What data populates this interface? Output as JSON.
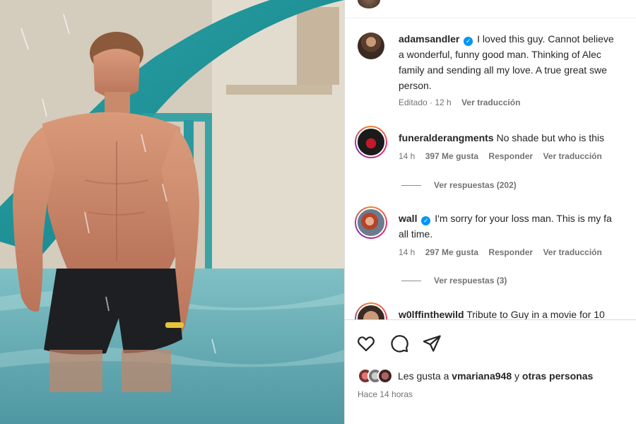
{
  "post": {
    "caption": {
      "username": "adamsandler",
      "lines": [
        "I loved this guy. Cannot believe",
        "a wonderful, funny good man. Thinking of Alec",
        "family and sending all my love. A true great swe",
        "person."
      ],
      "meta_edited": "Editado · 12 h",
      "meta_translate": "Ver traducción"
    },
    "comments": [
      {
        "username": "funeralderangments",
        "text": "No shade but who is this",
        "time": "14 h",
        "likes": "397 Me gusta",
        "reply": "Responder",
        "translate": "Ver traducción",
        "view_replies": "Ver respuestas (202)"
      },
      {
        "username": "wall",
        "text_lines": [
          "I'm sorry for your loss man. This is my fa",
          "all time."
        ],
        "time": "14 h",
        "likes": "297 Me gusta",
        "reply": "Responder",
        "translate": "Ver traducción",
        "view_replies": "Ver respuestas (3)"
      },
      {
        "username": "w0lffinthewild",
        "text": "Tribute to Guy in a movie for 10"
      }
    ],
    "actions": {
      "like_icon": "heart-icon",
      "comment_icon": "comment-bubble-icon",
      "share_icon": "paper-plane-icon"
    },
    "likes": {
      "prefix": "Les gusta a",
      "user": "vmariana948",
      "connector": "y",
      "suffix": "otras personas"
    },
    "time_ago": "Hace 14 horas",
    "colors": {
      "verified": "#0095f6",
      "secondary_text": "#737373",
      "primary_text": "#262626"
    }
  }
}
